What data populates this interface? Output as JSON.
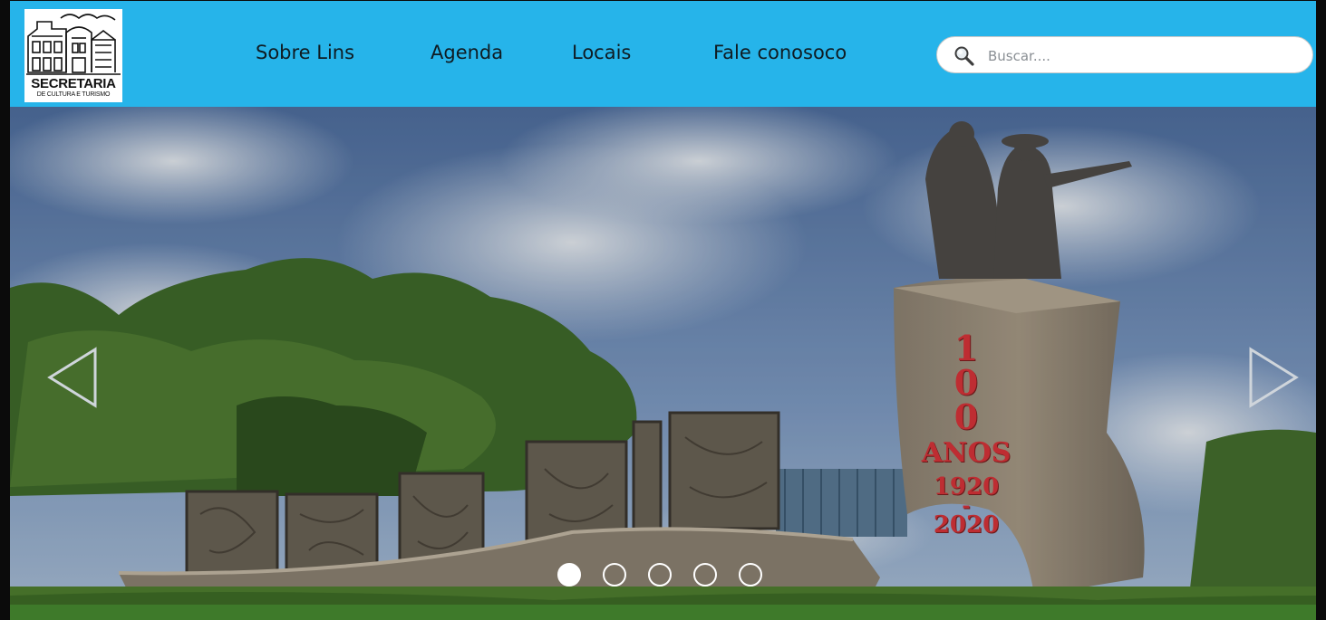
{
  "logo": {
    "title": "SECRETARIA",
    "subtitle": "DE CULTURA E TURISMO",
    "icon": "city-building-logo-icon"
  },
  "nav": {
    "items": [
      {
        "label": "Sobre Lins"
      },
      {
        "label": "Agenda"
      },
      {
        "label": "Locais"
      },
      {
        "label": "Fale conosoco"
      }
    ]
  },
  "search": {
    "placeholder": "Buscar....",
    "value": "",
    "icon": "search-icon"
  },
  "hero": {
    "monument_text": {
      "number": "100",
      "word": "ANOS",
      "year_start": "1920",
      "dash": "-",
      "year_end": "2020"
    },
    "prev_icon": "chevron-left-icon",
    "next_icon": "chevron-right-icon",
    "slides_count": 5,
    "active_slide": 1
  },
  "colors": {
    "header_bg": "#26b4ea",
    "nav_text": "#0f1b22",
    "monument_text": "#d9343a"
  }
}
